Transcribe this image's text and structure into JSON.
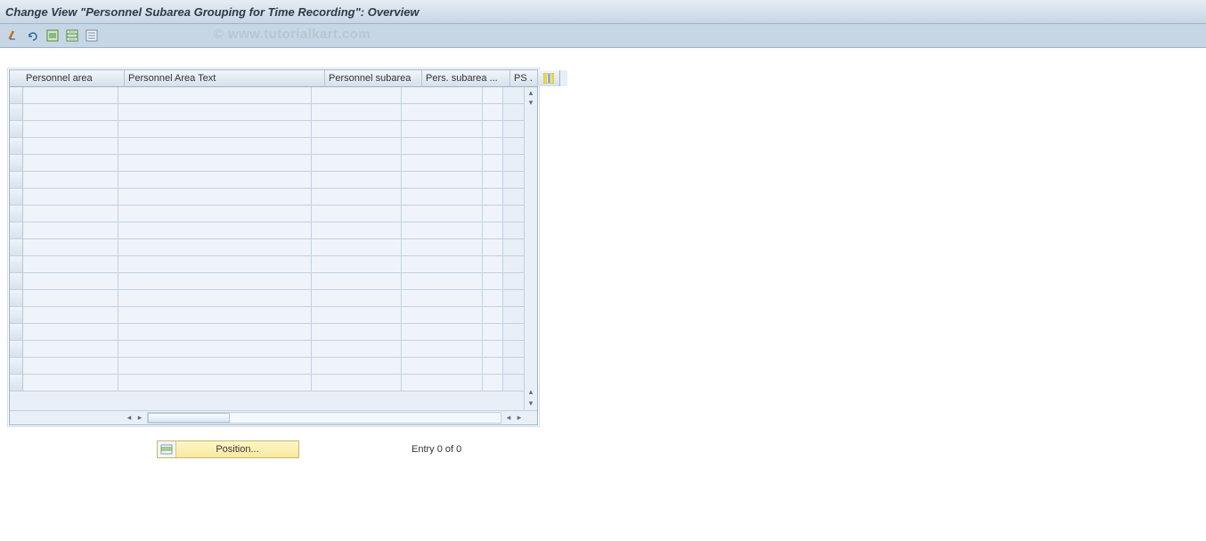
{
  "title": "Change View \"Personnel Subarea Grouping for Time Recording\": Overview",
  "watermark": "© www.tutorialkart.com",
  "columns": {
    "c0": "Personnel area",
    "c1": "Personnel Area Text",
    "c2": "Personnel subarea",
    "c3": "Pers. subarea ...",
    "c4": "PS ."
  },
  "footer": {
    "position_label": "Position...",
    "entry_text": "Entry 0 of 0"
  }
}
